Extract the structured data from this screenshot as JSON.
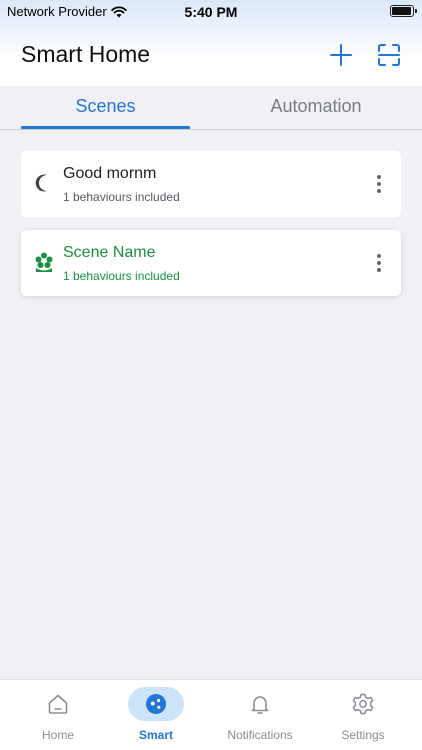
{
  "status_bar": {
    "carrier": "Network Provider",
    "time": "5:40 PM",
    "battery_level": 0.95
  },
  "header": {
    "title": "Smart Home",
    "add_icon": "plus-icon",
    "scan_icon": "scan-icon"
  },
  "tabs": [
    {
      "label": "Scenes",
      "active": true
    },
    {
      "label": "Automation",
      "active": false
    }
  ],
  "scenes": [
    {
      "name": "Good mornm",
      "subtitle": "1 behaviours included",
      "icon": "moon-icon",
      "color": "#333333"
    },
    {
      "name": "Scene Name",
      "subtitle": "1 behaviours included",
      "icon": "flower-icon",
      "color": "#1a9040"
    }
  ],
  "bottom_nav": [
    {
      "label": "Home",
      "icon": "home-icon",
      "active": false
    },
    {
      "label": "Smart",
      "icon": "smart-icon",
      "active": true
    },
    {
      "label": "Notifications",
      "icon": "bell-icon",
      "active": false
    },
    {
      "label": "Settings",
      "icon": "gear-icon",
      "active": false
    }
  ],
  "colors": {
    "accent": "#2176d6",
    "scene_active": "#1a9040",
    "background": "#f1f1f5"
  }
}
